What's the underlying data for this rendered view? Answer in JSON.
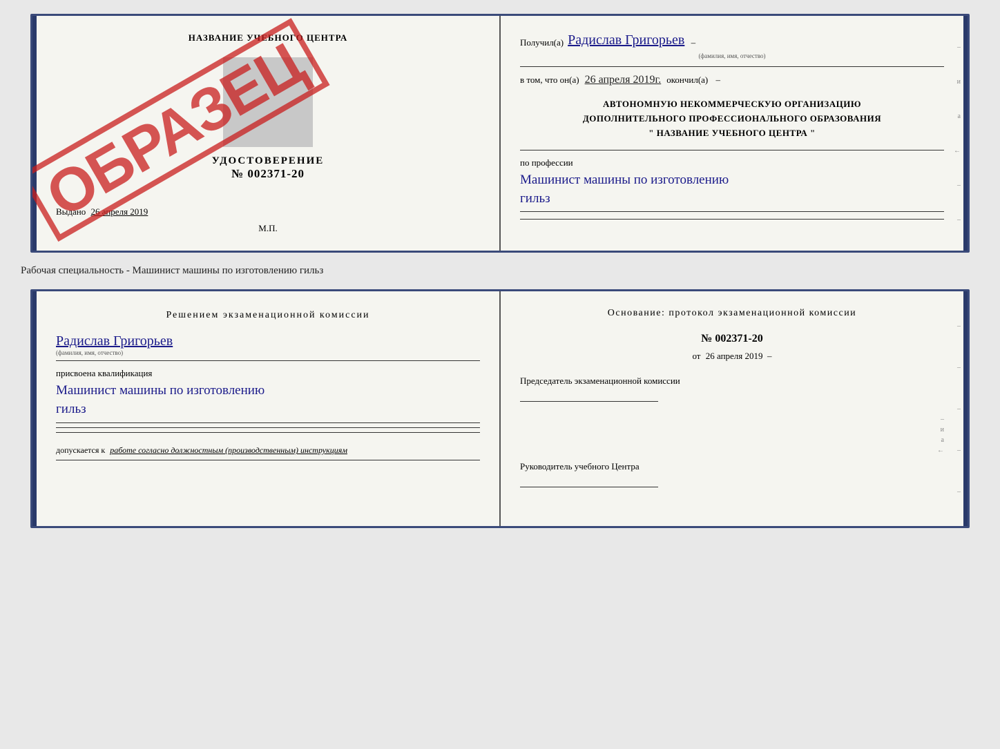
{
  "topDoc": {
    "left": {
      "institutionName": "НАЗВАНИЕ УЧЕБНОГО ЦЕНТРА",
      "certLabel": "УДОСТОВЕРЕНИЕ",
      "certNumber": "№ 002371-20",
      "issuedLabel": "Выдано",
      "issuedDate": "26 апреля 2019",
      "mpLabel": "М.П.",
      "stampText": "ОБРАЗЕЦ"
    },
    "right": {
      "receivedLabel": "Получил(а)",
      "recipientName": "Радислав Григорьев",
      "recipientSubtitle": "(фамилия, имя, отчество)",
      "datePrefix": "в том, что он(а)",
      "date": "26 апреля 2019г.",
      "datePostfix": "окончил(а)",
      "orgLine1": "АВТОНОМНУЮ НЕКОММЕРЧЕСКУЮ ОРГАНИЗАЦИЮ",
      "orgLine2": "ДОПОЛНИТЕЛЬНОГО ПРОФЕССИОНАЛЬНОГО ОБРАЗОВАНИЯ",
      "orgLine3": "\" НАЗВАНИЕ УЧЕБНОГО ЦЕНТРА \"",
      "professionLabel": "по профессии",
      "profession1": "Машинист машины по изготовлению",
      "profession2": "гильз"
    }
  },
  "specialtyLabel": "Рабочая специальность - Машинист машины по изготовлению гильз",
  "bottomDoc": {
    "left": {
      "commissionTitle": "Решением  экзаменационной  комиссии",
      "nameLabel": "",
      "name": "Радислав Григорьев",
      "nameSubtitle": "(фамилия, имя, отчество)",
      "qualificationLabel": "присвоена квалификация",
      "qualification1": "Машинист машины по изготовлению",
      "qualification2": "гильз",
      "allowPrefix": "допускается к",
      "allowText": "работе согласно должностным (производственным) инструкциям"
    },
    "right": {
      "foundationTitle": "Основание:  протокол  экзаменационной  комиссии",
      "protocolNumber": "№  002371-20",
      "datePrefix": "от",
      "date": "26 апреля 2019",
      "chairmanLabel": "Председатель экзаменационной комиссии",
      "directorLabel": "Руководитель учебного Центра"
    }
  }
}
